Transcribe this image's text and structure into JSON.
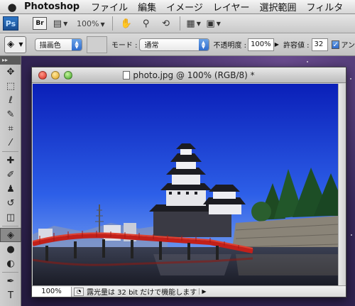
{
  "menubar": {
    "app_name": "Photoshop",
    "menus": [
      "ファイル",
      "編集",
      "イメージ",
      "レイヤー",
      "選択範囲",
      "フィルタ"
    ]
  },
  "appbar": {
    "ps_logo": "Ps",
    "br_logo": "Br",
    "zoom": "100%"
  },
  "options": {
    "fill_source": "描画色",
    "mode_label": "モード :",
    "mode_value": "通常",
    "opacity_label": "不透明度 :",
    "opacity_value": "100%",
    "tolerance_label": "許容値 :",
    "tolerance_value": "32",
    "antialias_label": "アン"
  },
  "document": {
    "title": "photo.jpg @ 100% (RGB/8) *",
    "zoom": "100%",
    "status_text": "露光量は 32 bit だけで機能します"
  },
  "tools": {
    "items": [
      {
        "name": "move-tool",
        "icon": "✥"
      },
      {
        "name": "marquee-tool",
        "icon": "⬚"
      },
      {
        "name": "lasso-tool",
        "icon": "ℓ"
      },
      {
        "name": "quick-selection-tool",
        "icon": "✎"
      },
      {
        "name": "crop-tool",
        "icon": "⌗"
      },
      {
        "name": "eyedropper-tool",
        "icon": "⁄"
      },
      {
        "name": "healing-brush-tool",
        "icon": "✚"
      },
      {
        "name": "brush-tool",
        "icon": "✐"
      },
      {
        "name": "clone-stamp-tool",
        "icon": "♟"
      },
      {
        "name": "history-brush-tool",
        "icon": "↺"
      },
      {
        "name": "eraser-tool",
        "icon": "◫"
      },
      {
        "name": "paint-bucket-tool",
        "icon": "◈"
      },
      {
        "name": "blur-tool",
        "icon": "●"
      },
      {
        "name": "dodge-tool",
        "icon": "◐"
      },
      {
        "name": "pen-tool",
        "icon": "✒"
      },
      {
        "name": "type-tool",
        "icon": "T"
      }
    ]
  }
}
